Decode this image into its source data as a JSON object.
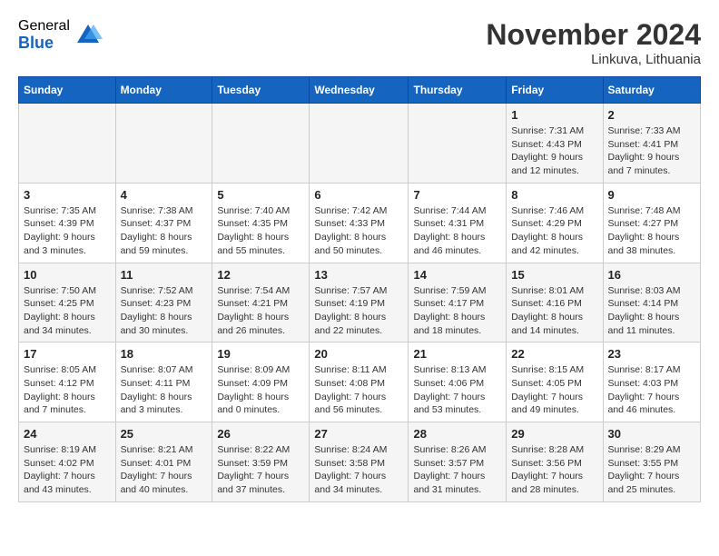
{
  "header": {
    "logo_general": "General",
    "logo_blue": "Blue",
    "month_title": "November 2024",
    "location": "Linkuva, Lithuania"
  },
  "weekdays": [
    "Sunday",
    "Monday",
    "Tuesday",
    "Wednesday",
    "Thursday",
    "Friday",
    "Saturday"
  ],
  "weeks": [
    [
      {
        "day": "",
        "info": ""
      },
      {
        "day": "",
        "info": ""
      },
      {
        "day": "",
        "info": ""
      },
      {
        "day": "",
        "info": ""
      },
      {
        "day": "",
        "info": ""
      },
      {
        "day": "1",
        "info": "Sunrise: 7:31 AM\nSunset: 4:43 PM\nDaylight: 9 hours and 12 minutes."
      },
      {
        "day": "2",
        "info": "Sunrise: 7:33 AM\nSunset: 4:41 PM\nDaylight: 9 hours and 7 minutes."
      }
    ],
    [
      {
        "day": "3",
        "info": "Sunrise: 7:35 AM\nSunset: 4:39 PM\nDaylight: 9 hours and 3 minutes."
      },
      {
        "day": "4",
        "info": "Sunrise: 7:38 AM\nSunset: 4:37 PM\nDaylight: 8 hours and 59 minutes."
      },
      {
        "day": "5",
        "info": "Sunrise: 7:40 AM\nSunset: 4:35 PM\nDaylight: 8 hours and 55 minutes."
      },
      {
        "day": "6",
        "info": "Sunrise: 7:42 AM\nSunset: 4:33 PM\nDaylight: 8 hours and 50 minutes."
      },
      {
        "day": "7",
        "info": "Sunrise: 7:44 AM\nSunset: 4:31 PM\nDaylight: 8 hours and 46 minutes."
      },
      {
        "day": "8",
        "info": "Sunrise: 7:46 AM\nSunset: 4:29 PM\nDaylight: 8 hours and 42 minutes."
      },
      {
        "day": "9",
        "info": "Sunrise: 7:48 AM\nSunset: 4:27 PM\nDaylight: 8 hours and 38 minutes."
      }
    ],
    [
      {
        "day": "10",
        "info": "Sunrise: 7:50 AM\nSunset: 4:25 PM\nDaylight: 8 hours and 34 minutes."
      },
      {
        "day": "11",
        "info": "Sunrise: 7:52 AM\nSunset: 4:23 PM\nDaylight: 8 hours and 30 minutes."
      },
      {
        "day": "12",
        "info": "Sunrise: 7:54 AM\nSunset: 4:21 PM\nDaylight: 8 hours and 26 minutes."
      },
      {
        "day": "13",
        "info": "Sunrise: 7:57 AM\nSunset: 4:19 PM\nDaylight: 8 hours and 22 minutes."
      },
      {
        "day": "14",
        "info": "Sunrise: 7:59 AM\nSunset: 4:17 PM\nDaylight: 8 hours and 18 minutes."
      },
      {
        "day": "15",
        "info": "Sunrise: 8:01 AM\nSunset: 4:16 PM\nDaylight: 8 hours and 14 minutes."
      },
      {
        "day": "16",
        "info": "Sunrise: 8:03 AM\nSunset: 4:14 PM\nDaylight: 8 hours and 11 minutes."
      }
    ],
    [
      {
        "day": "17",
        "info": "Sunrise: 8:05 AM\nSunset: 4:12 PM\nDaylight: 8 hours and 7 minutes."
      },
      {
        "day": "18",
        "info": "Sunrise: 8:07 AM\nSunset: 4:11 PM\nDaylight: 8 hours and 3 minutes."
      },
      {
        "day": "19",
        "info": "Sunrise: 8:09 AM\nSunset: 4:09 PM\nDaylight: 8 hours and 0 minutes."
      },
      {
        "day": "20",
        "info": "Sunrise: 8:11 AM\nSunset: 4:08 PM\nDaylight: 7 hours and 56 minutes."
      },
      {
        "day": "21",
        "info": "Sunrise: 8:13 AM\nSunset: 4:06 PM\nDaylight: 7 hours and 53 minutes."
      },
      {
        "day": "22",
        "info": "Sunrise: 8:15 AM\nSunset: 4:05 PM\nDaylight: 7 hours and 49 minutes."
      },
      {
        "day": "23",
        "info": "Sunrise: 8:17 AM\nSunset: 4:03 PM\nDaylight: 7 hours and 46 minutes."
      }
    ],
    [
      {
        "day": "24",
        "info": "Sunrise: 8:19 AM\nSunset: 4:02 PM\nDaylight: 7 hours and 43 minutes."
      },
      {
        "day": "25",
        "info": "Sunrise: 8:21 AM\nSunset: 4:01 PM\nDaylight: 7 hours and 40 minutes."
      },
      {
        "day": "26",
        "info": "Sunrise: 8:22 AM\nSunset: 3:59 PM\nDaylight: 7 hours and 37 minutes."
      },
      {
        "day": "27",
        "info": "Sunrise: 8:24 AM\nSunset: 3:58 PM\nDaylight: 7 hours and 34 minutes."
      },
      {
        "day": "28",
        "info": "Sunrise: 8:26 AM\nSunset: 3:57 PM\nDaylight: 7 hours and 31 minutes."
      },
      {
        "day": "29",
        "info": "Sunrise: 8:28 AM\nSunset: 3:56 PM\nDaylight: 7 hours and 28 minutes."
      },
      {
        "day": "30",
        "info": "Sunrise: 8:29 AM\nSunset: 3:55 PM\nDaylight: 7 hours and 25 minutes."
      }
    ]
  ]
}
